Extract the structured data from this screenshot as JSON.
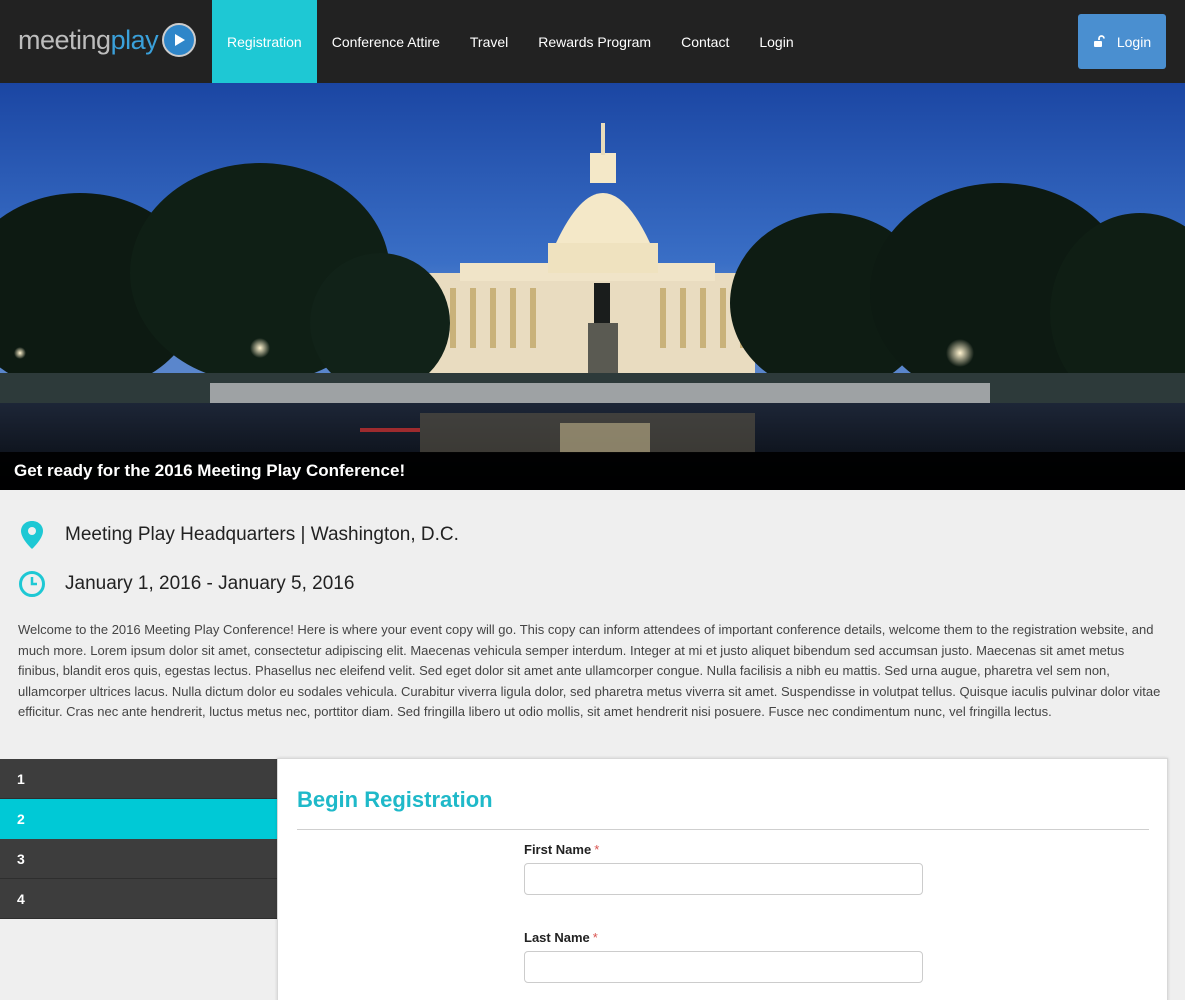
{
  "brand": {
    "word1": "meeting",
    "word2": "play"
  },
  "nav": {
    "items": [
      "Registration",
      "Conference Attire",
      "Travel",
      "Rewards Program",
      "Contact",
      "Login"
    ],
    "active_index": 0,
    "login_button": "Login"
  },
  "hero": {
    "caption": "Get ready for the 2016 Meeting Play Conference!"
  },
  "event": {
    "location": "Meeting Play Headquarters | Washington, D.C.",
    "dates": "January 1, 2016 - January 5, 2016",
    "description": "Welcome to the 2016 Meeting Play Conference! Here is where your event copy will go. This copy can inform attendees of important conference details, welcome them to the registration website, and much more. Lorem ipsum dolor sit amet, consectetur adipiscing elit. Maecenas vehicula semper interdum. Integer at mi et justo aliquet bibendum sed accumsan justo. Maecenas sit amet metus finibus, blandit eros quis, egestas lectus. Phasellus nec eleifend velit. Sed eget dolor sit amet ante ullamcorper congue. Nulla facilisis a nibh eu mattis. Sed urna augue, pharetra vel sem non, ullamcorper ultrices lacus. Nulla dictum dolor eu sodales vehicula. Curabitur viverra ligula dolor, sed pharetra metus viverra sit amet. Suspendisse in volutpat tellus. Quisque iaculis pulvinar dolor vitae efficitur. Cras nec ante hendrerit, luctus metus nec, porttitor diam. Sed fringilla libero ut odio mollis, sit amet hendrerit nisi posuere. Fusce nec condimentum nunc, vel fringilla lectus."
  },
  "steps": {
    "items": [
      "1",
      "2",
      "3",
      "4"
    ],
    "active_index": 1
  },
  "form": {
    "title": "Begin Registration",
    "fields": [
      {
        "label": "First Name",
        "required_mark": "*",
        "value": "",
        "placeholder": ""
      },
      {
        "label": "Last Name",
        "required_mark": "*",
        "value": "",
        "placeholder": ""
      }
    ]
  },
  "colors": {
    "accent": "#00c9d6",
    "nav_bg": "#222222",
    "login_button": "#4a8fd0",
    "step_bg": "#3d3d3d"
  },
  "icons": {
    "location": "map-pin-icon",
    "dates": "clock-icon",
    "login": "unlock-icon",
    "logo": "play-icon"
  }
}
